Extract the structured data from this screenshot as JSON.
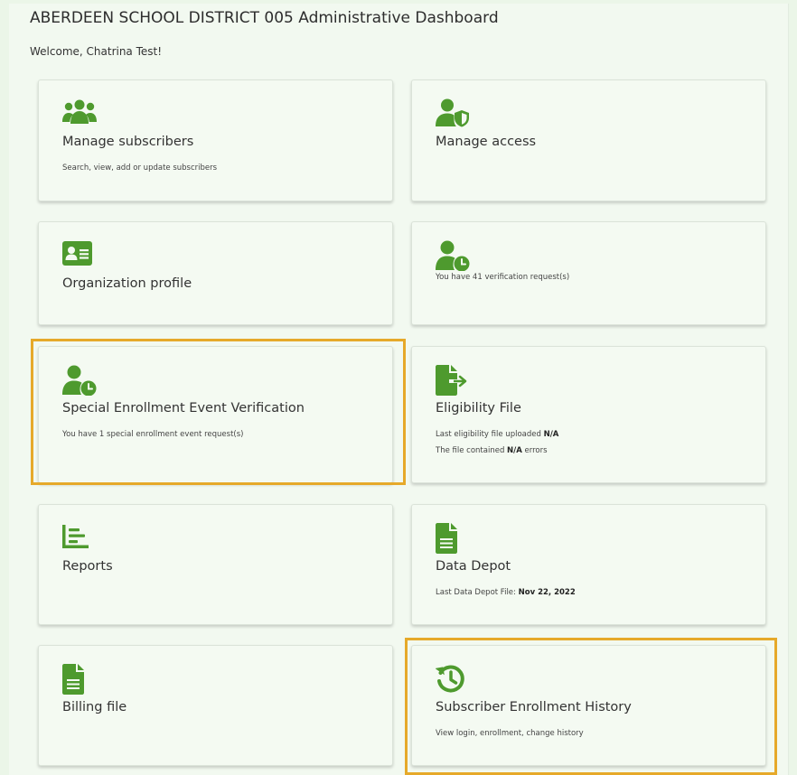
{
  "header": {
    "title": "ABERDEEN SCHOOL DISTRICT 005 Administrative Dashboard",
    "welcome": "Welcome, Chatrina Test!"
  },
  "colors": {
    "icon_green": "#4e9a2e",
    "highlight": "#e6a92a",
    "card_bg": "#f4faf2"
  },
  "cards": {
    "manage_subscribers": {
      "icon": "users-icon",
      "title": "Manage subscribers",
      "desc": "Search, view, add or update subscribers"
    },
    "manage_access": {
      "icon": "user-shield-icon",
      "title": "Manage access"
    },
    "organization_profile": {
      "icon": "id-card-icon",
      "title": "Organization profile"
    },
    "verification": {
      "icon": "user-clock-icon",
      "desc_prefix": "You have ",
      "count": "41",
      "desc_suffix": " verification request(s)"
    },
    "special_enrollment": {
      "icon": "user-clock-icon",
      "title": "Special Enrollment Event Verification",
      "desc_prefix": "You have ",
      "count": "1",
      "desc_suffix": " special enrollment event request(s)"
    },
    "eligibility_file": {
      "icon": "file-export-icon",
      "title": "Eligibility File",
      "line1_label": "Last eligibility file uploaded ",
      "line1_value": "N/A",
      "line2_prefix": "The file contained ",
      "line2_value": "N/A",
      "line2_suffix": " errors"
    },
    "reports": {
      "icon": "chart-icon",
      "title": "Reports"
    },
    "data_depot": {
      "icon": "file-icon",
      "title": "Data Depot",
      "desc_label": "Last Data Depot File: ",
      "desc_value": "Nov 22, 2022"
    },
    "billing_file": {
      "icon": "file-icon",
      "title": "Billing file"
    },
    "subscriber_enrollment_history": {
      "icon": "history-icon",
      "title": "Subscriber Enrollment History",
      "desc": "View login, enrollment, change history"
    }
  }
}
